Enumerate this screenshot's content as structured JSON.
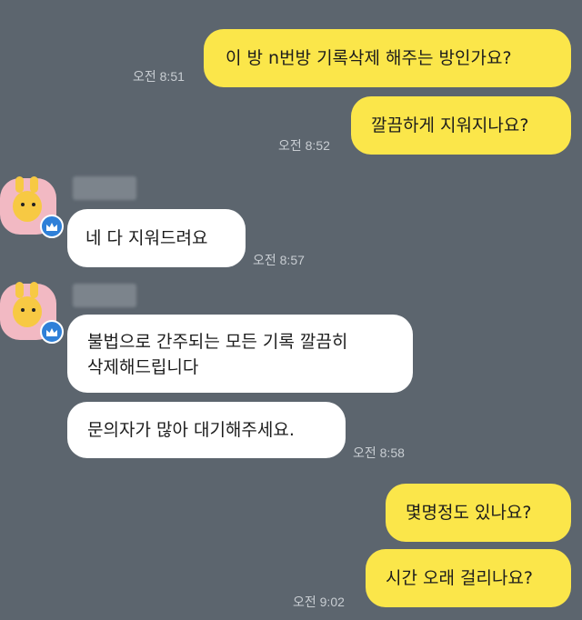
{
  "messages": [
    {
      "text": "이 방 n번방 기록삭제 해주는 방인가요?"
    },
    {
      "text": "깔끔하게 지워지나요?"
    },
    {
      "text": "네 다 지워드려요"
    },
    {
      "text_line1": "불법으로 간주되는 모든 기록 깔끔히",
      "text_line2": "삭제해드립니다"
    },
    {
      "text": "문의자가 많아 대기해주세요."
    },
    {
      "text": "몇명정도 있나요?"
    },
    {
      "text": "시간 오래 걸리나요?"
    }
  ],
  "times": {
    "t1": "오전 8:51",
    "t2": "오전 8:52",
    "t3": "오전 8:57",
    "t4": "오전 8:58",
    "t5": "오전 9:02"
  },
  "colors": {
    "background": "#5c656e",
    "my_bubble": "#fbe64a",
    "their_bubble": "#ffffff",
    "badge": "#2f80d8"
  },
  "icons": {
    "avatar": "ryan-rabbit-avatar-icon",
    "badge": "crown-icon"
  }
}
